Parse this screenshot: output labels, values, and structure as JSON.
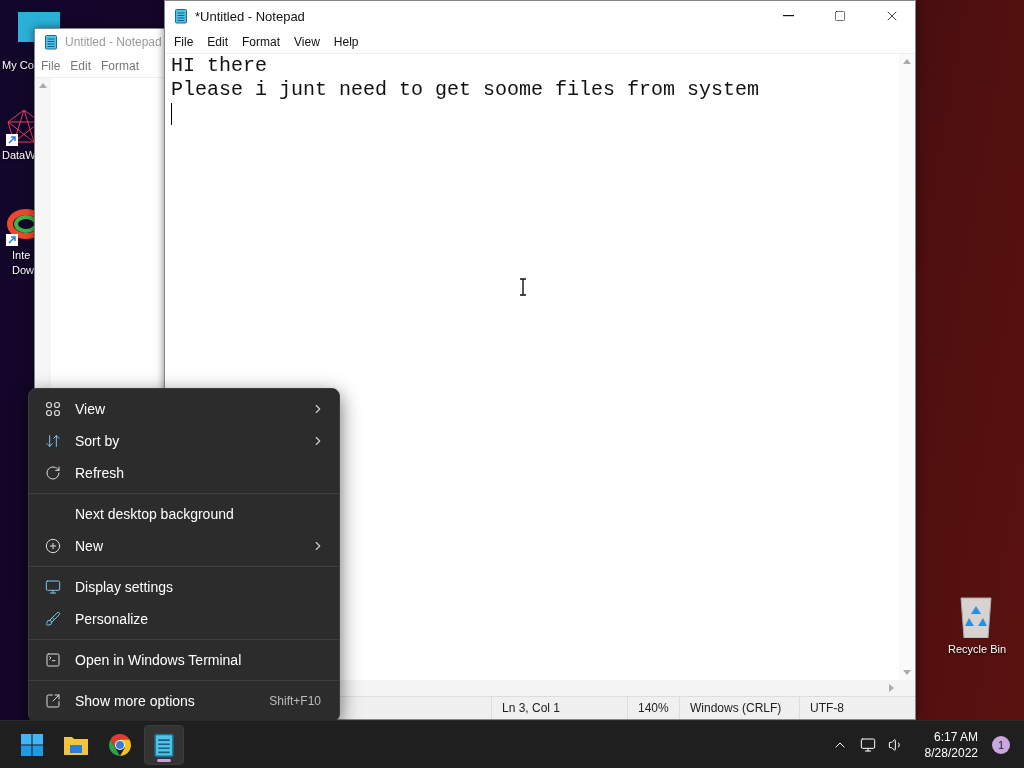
{
  "desktop": {
    "icons": [
      {
        "lines": [
          "My Co"
        ]
      },
      {
        "lines": [
          "DataW"
        ]
      },
      {
        "lines": [
          "Inte",
          "Dow"
        ]
      }
    ],
    "recycle_bin": {
      "label": "Recycle Bin"
    }
  },
  "background_window": {
    "title": "Untitled - Notepad",
    "menu": [
      "File",
      "Edit",
      "Format"
    ]
  },
  "notepad": {
    "title": "*Untitled - Notepad",
    "menu": [
      "File",
      "Edit",
      "Format",
      "View",
      "Help"
    ],
    "lines": [
      "HI there",
      "Please i junt need to get soome files from system"
    ],
    "status_bar": [
      "Ln 3, Col 1",
      "140%",
      "Windows (CRLF)",
      "UTF-8"
    ]
  },
  "context_menu": {
    "groups": [
      [
        {
          "label": "View",
          "submenu": true
        },
        {
          "label": "Sort by",
          "submenu": true
        },
        {
          "label": "Refresh",
          "submenu": false
        }
      ],
      [
        {
          "label": "Next desktop background",
          "submenu": false
        },
        {
          "label": "New",
          "submenu": true
        }
      ],
      [
        {
          "label": "Display settings",
          "submenu": false
        },
        {
          "label": "Personalize",
          "submenu": false
        }
      ],
      [
        {
          "label": "Open in Windows Terminal",
          "submenu": false
        }
      ],
      [
        {
          "label": "Show more options",
          "submenu": false,
          "shortcut": "Shift+F10"
        }
      ]
    ]
  },
  "taskbar": {
    "apps": [
      {
        "selected": false
      },
      {
        "selected": false
      },
      {
        "selected": false
      },
      {
        "selected": true
      }
    ],
    "clock": {
      "time": "6:17 AM",
      "date": "8/28/2022"
    },
    "notifications": "1"
  }
}
